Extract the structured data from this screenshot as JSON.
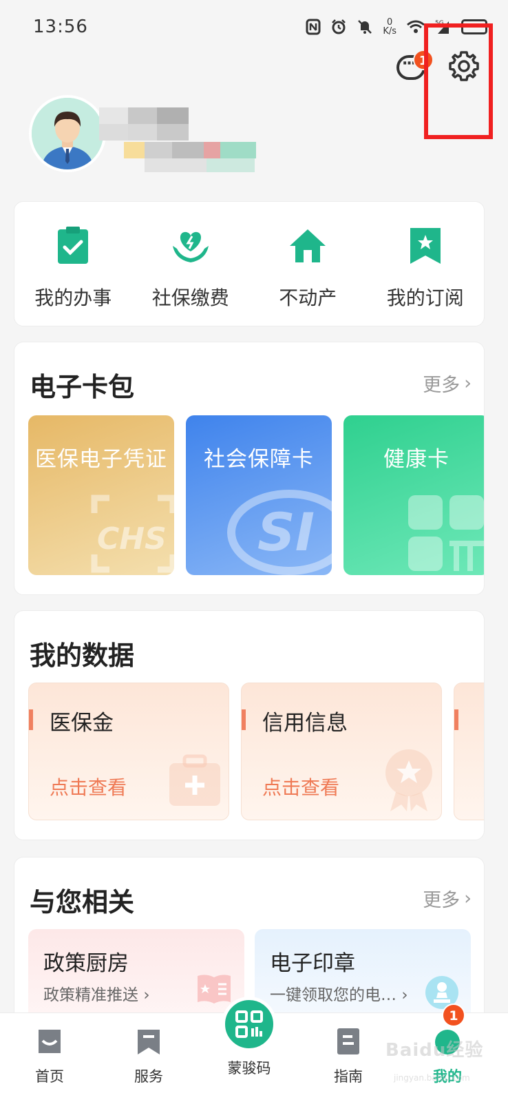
{
  "status_bar": {
    "time": "13:56",
    "net_speed_value": "0",
    "net_speed_unit": "K/s",
    "signal_tag": "5G",
    "icons": [
      "nfc-icon",
      "alarm-icon",
      "mute-icon",
      "wifi-icon",
      "signal-icon",
      "battery-icon"
    ]
  },
  "header": {
    "message_badge": "1",
    "icons": [
      "message-icon",
      "settings-gear-icon"
    ]
  },
  "quick_actions": [
    {
      "label": "我的办事",
      "icon": "clipboard-check-icon"
    },
    {
      "label": "社保缴费",
      "icon": "hands-heart-icon"
    },
    {
      "label": "不动产",
      "icon": "house-icon"
    },
    {
      "label": "我的订阅",
      "icon": "bookmark-star-icon"
    }
  ],
  "wallet": {
    "title": "电子卡包",
    "more": "更多",
    "cards": [
      {
        "title": "医保电子凭证",
        "color": "#e9c079"
      },
      {
        "title": "社会保障卡",
        "color": "#5b93ea"
      },
      {
        "title": "健康卡",
        "color": "#3fd79a"
      }
    ]
  },
  "my_data": {
    "title": "我的数据",
    "cards": [
      {
        "title": "医保金",
        "action": "点击查看"
      },
      {
        "title": "信用信息",
        "action": "点击查看"
      }
    ]
  },
  "related": {
    "title": "与您相关",
    "more": "更多",
    "cards": [
      {
        "title": "政策厨房",
        "subtitle": "政策精准推送",
        "color": "#fdeeee"
      },
      {
        "title": "电子印章",
        "subtitle": "一键领取您的电…",
        "color": "#eaf3fd"
      }
    ]
  },
  "bottom_nav": {
    "items": [
      {
        "label": "首页"
      },
      {
        "label": "服务"
      },
      {
        "label": "蒙骏码"
      },
      {
        "label": "指南"
      },
      {
        "label": "我的"
      }
    ],
    "badge": "1"
  },
  "watermark": {
    "text": "Baidu经验",
    "sub": "jingyan.baidu.com"
  },
  "colors": {
    "accent": "#1fb68b",
    "badge": "#f2511f",
    "highlight": "#f02020"
  }
}
